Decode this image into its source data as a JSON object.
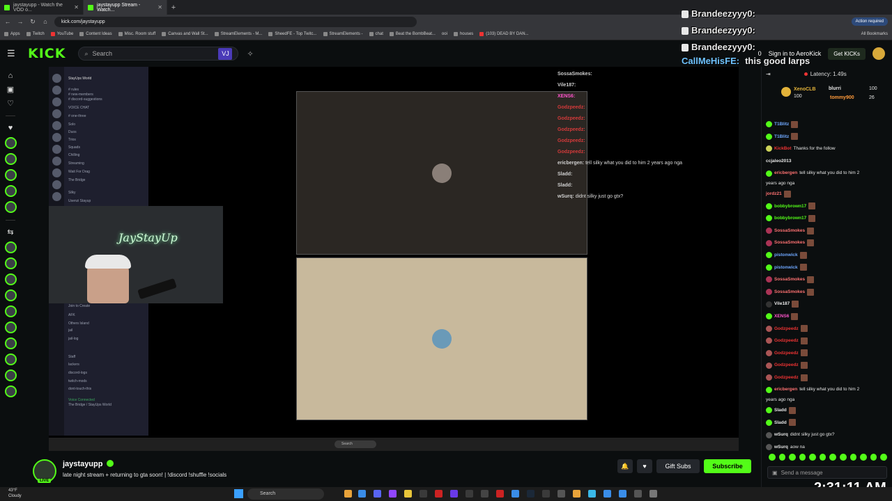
{
  "browser": {
    "tabs": [
      {
        "label": "jaystayupp - Watch the VOD o..."
      },
      {
        "label": "jaystayupp Stream - Watch..."
      }
    ],
    "url": "kick.com/jaystayupp",
    "action_required": "Action required",
    "bookmarks": [
      "Apps",
      "Twitch",
      "YouTube",
      "Content Ideas",
      "Misc. Room stuff",
      "Canvas and Wall St...",
      "StreamElements - M...",
      "SheedFE - Top Twitc...",
      "StreamElements -",
      "chat",
      "Beat the BombBeat...",
      "ooi",
      "houses",
      "(103) DEAD BY DAN..."
    ],
    "all_bookmarks": "All Bookmarks"
  },
  "kick": {
    "logo": "KICK",
    "search_placeholder": "Search",
    "vj_badge": "VJ",
    "count": "0",
    "sign_in": "Sign in to AeroKick",
    "get_kicks": "Get KICKs"
  },
  "video": {
    "server_title": "StayUps World",
    "channels": [
      "# rules",
      "# new-members",
      "# discord-suggestions",
      "VOICE CHAT",
      "# one-three",
      "Solo",
      "Duos",
      "Trios",
      "Squads",
      "Chilling",
      "Streaming",
      "Wait For Drag",
      "The Bridge",
      "Silky",
      "Usenzi Stayup",
      "Join to Create",
      "AFK",
      "Others Island",
      "jail",
      "jail-log",
      "Staff",
      "lackers",
      "discord-logs",
      "twitch-mods",
      "dont-touch-this",
      "Voice Connected",
      "The Bridge / StayUps World"
    ],
    "neon_sign": "JayStayUp",
    "overlay_chat": [
      {
        "user": "SossaSmokes:",
        "text": ""
      },
      {
        "user": "Vile187:",
        "text": ""
      },
      {
        "user": "XENS6:",
        "text": ""
      },
      {
        "user": "Godzpeedz:",
        "text": ""
      },
      {
        "user": "Godzpeedz:",
        "text": ""
      },
      {
        "user": "Godzpeedz:",
        "text": ""
      },
      {
        "user": "Godzpeedz:",
        "text": ""
      },
      {
        "user": "Godzpeedz:",
        "text": ""
      },
      {
        "user": "ericbergen:",
        "text": "tell silky what you did to him 2 years ago nga"
      },
      {
        "user": "Sladd:",
        "text": ""
      },
      {
        "user": "Sladd:",
        "text": ""
      },
      {
        "user": "wSurq:",
        "text": "didnt silky just go gtx?"
      }
    ],
    "taskbar_search": "Search"
  },
  "alerts": {
    "lines": [
      "Brandeezyyy0:",
      "Brandeezyyy0:",
      "Brandeezyyy0:"
    ],
    "bottom_user": "CallMeHisFE:",
    "bottom_text": "this good larps"
  },
  "stream": {
    "streamer": "jaystayupp",
    "live": "LIVE",
    "title": "late night stream + returning to gta soon! | !discord !shuffle !socials",
    "gift_subs": "Gift Subs",
    "subscribe": "Subscribe"
  },
  "chat": {
    "latency": "Latency: 1.49s",
    "leaderboard": [
      {
        "name": "XenoCLB",
        "count": "100"
      },
      {
        "name": "blurri",
        "count": "100"
      },
      {
        "name": "tommy900",
        "count": "26"
      }
    ],
    "messages": [
      {
        "user": "T1Blitz",
        "text": "",
        "color": "#6fa8ff"
      },
      {
        "user": "T1Blitz",
        "text": "",
        "color": "#6fa8ff"
      },
      {
        "user": "KickBot",
        "text": "Thanks for the follow",
        "color": "#e33"
      },
      {
        "user": "ccjaleo2013",
        "text": "",
        "color": "#e6e6e6"
      },
      {
        "user": "ericbergen",
        "text": "tell silky what you did to him 2",
        "color": "#ff7272"
      },
      {
        "user": "",
        "text": "years ago nga",
        "color": "#e6e6e6"
      },
      {
        "user": "jordz21",
        "text": "",
        "color": "#ff7272"
      },
      {
        "user": "bobbybrown17",
        "text": "",
        "color": "#53fc18"
      },
      {
        "user": "bobbybrown17",
        "text": "",
        "color": "#53fc18"
      },
      {
        "user": "SossaSmokes",
        "text": "",
        "color": "#ff7272"
      },
      {
        "user": "SossaSmokes",
        "text": "",
        "color": "#ff7272"
      },
      {
        "user": "pistonwick",
        "text": "",
        "color": "#6fa8ff"
      },
      {
        "user": "pistonwick",
        "text": "",
        "color": "#6fa8ff"
      },
      {
        "user": "SossaSmokes",
        "text": "",
        "color": "#ff7272"
      },
      {
        "user": "SossaSmokes",
        "text": "",
        "color": "#ff7272"
      },
      {
        "user": "Vile187",
        "text": "",
        "color": "#e6e6e6"
      },
      {
        "user": "XENS6",
        "text": "",
        "color": "#ff55cc"
      },
      {
        "user": "Godzpeedz",
        "text": "",
        "color": "#e33"
      },
      {
        "user": "Godzpeedz",
        "text": "",
        "color": "#e33"
      },
      {
        "user": "Godzpeedz",
        "text": "",
        "color": "#e33"
      },
      {
        "user": "Godzpeedz",
        "text": "",
        "color": "#e33"
      },
      {
        "user": "Godzpeedz",
        "text": "",
        "color": "#e33"
      },
      {
        "user": "ericbergen",
        "text": "tell silky what you did to him 2",
        "color": "#ff7272"
      },
      {
        "user": "",
        "text": "years ago nga",
        "color": "#e6e6e6"
      },
      {
        "user": "Sladd",
        "text": "",
        "color": "#e6e6e6"
      },
      {
        "user": "Sladd",
        "text": "",
        "color": "#e6e6e6"
      },
      {
        "user": "wSurq",
        "text": "didnt silky just go gtx?",
        "color": "#e6e6e6"
      },
      {
        "user": "wSurq",
        "text": "aow na",
        "color": "#e6e6e6"
      }
    ],
    "send_placeholder": "Send a message"
  },
  "system": {
    "clock": "2:31:11 AM",
    "weather_temp": "43°F",
    "weather_desc": "Cloudy",
    "search": "Search"
  },
  "colors": {
    "kick_green": "#53fc18",
    "background": "#0b0e0f"
  }
}
